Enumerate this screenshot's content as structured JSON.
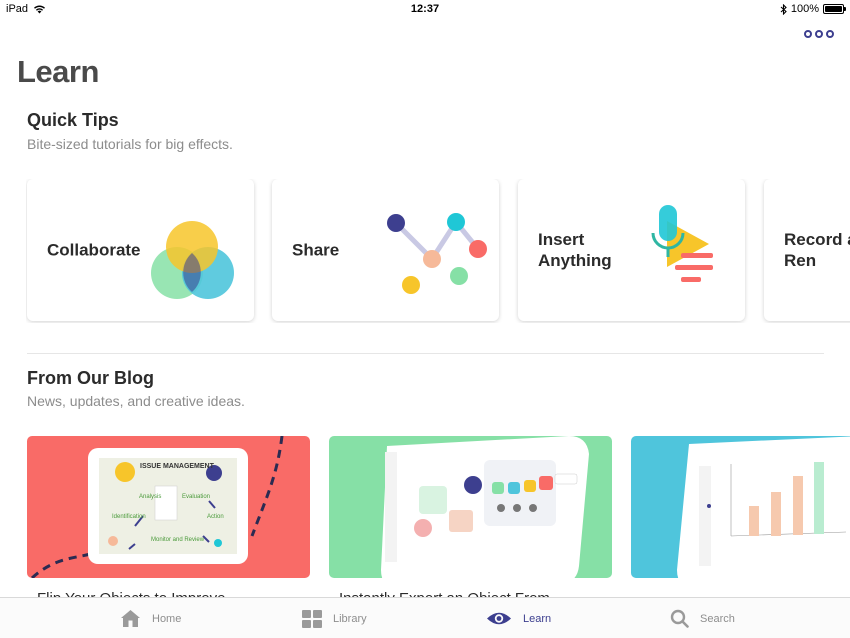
{
  "status": {
    "device": "iPad",
    "time": "12:37",
    "battery": "100%"
  },
  "page": {
    "title": "Learn"
  },
  "quick_tips": {
    "title": "Quick Tips",
    "subtitle": "Bite-sized tutorials for big effects.",
    "cards": [
      {
        "label": "Collaborate"
      },
      {
        "label": "Share"
      },
      {
        "label": "Insert Anything"
      },
      {
        "label": "Record and Ren"
      }
    ]
  },
  "blog": {
    "title": "From Our Blog",
    "subtitle": "News, updates, and creative ideas.",
    "posts": [
      {
        "title": "Flip Your Objects to Improve",
        "thumb_bg": "#f96b67",
        "thumb_heading": "ISSUE MANAGEMENT",
        "labels": [
          "Analysis",
          "Evaluation",
          "Identification",
          "Action",
          "Monitor and Review"
        ]
      },
      {
        "title": "Instantly Export an Object From",
        "thumb_bg": "#86e0a6"
      },
      {
        "title": "",
        "thumb_bg": "#4fc5dc"
      }
    ]
  },
  "tabs": [
    {
      "label": "Home",
      "icon": "home-icon"
    },
    {
      "label": "Library",
      "icon": "library-icon"
    },
    {
      "label": "Learn",
      "icon": "eye-icon",
      "active": true
    },
    {
      "label": "Search",
      "icon": "search-icon"
    }
  ],
  "colors": {
    "accent": "#3d3f8f",
    "coral": "#f96b67",
    "mint": "#86e0a6",
    "teal": "#4fc5dc",
    "yellow": "#f7c52a"
  }
}
